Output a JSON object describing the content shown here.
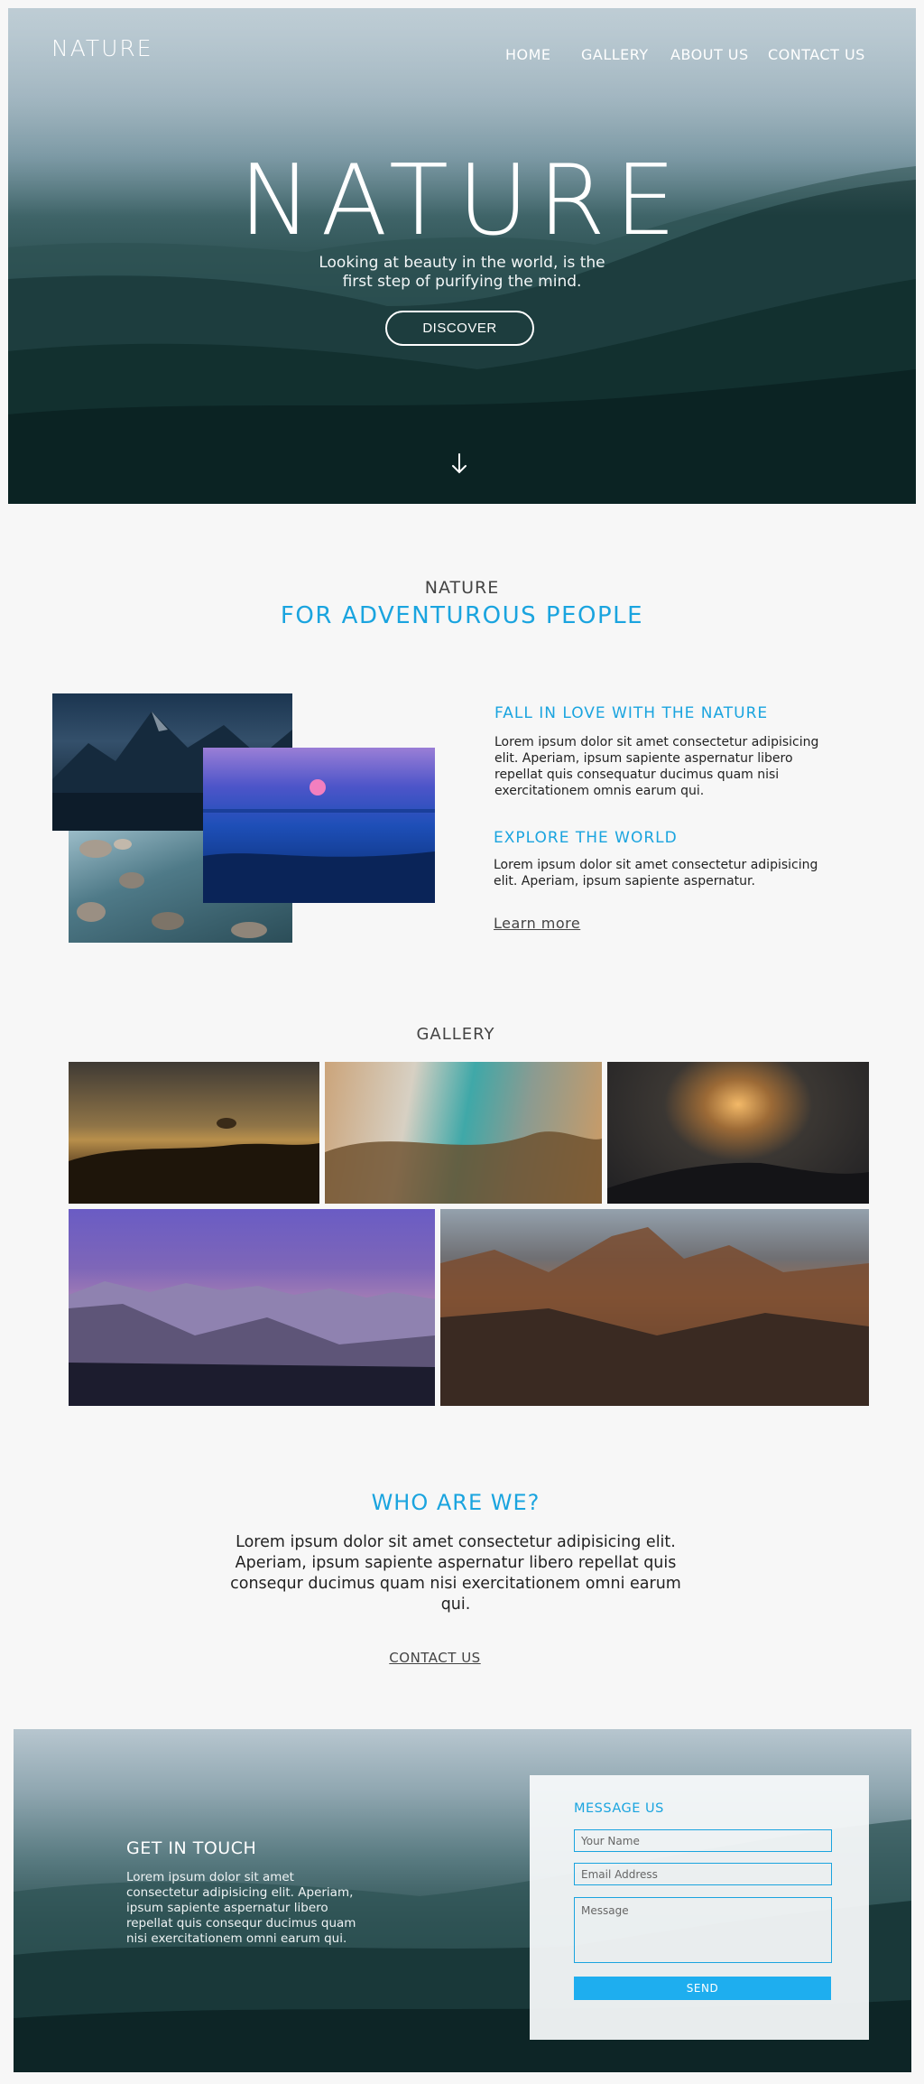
{
  "brand": {
    "logo": "NATURE",
    "accent": "#1aa4df"
  },
  "nav": {
    "items": [
      {
        "label": "HOME"
      },
      {
        "label": "GALLERY"
      },
      {
        "label": "ABOUT US"
      },
      {
        "label": "CONTACT US"
      }
    ]
  },
  "hero": {
    "title": "NATURE",
    "subtitle_line1": "Looking at beauty in the world, is the",
    "subtitle_line2": "first step of purifying the mind.",
    "cta": "DISCOVER",
    "scroll_icon": "arrow-down-icon"
  },
  "intro": {
    "kicker": "NATURE",
    "heading": "FOR ADVENTUROUS PEOPLE",
    "features": [
      {
        "title": "FALL IN LOVE WITH THE NATURE",
        "text": "Lorem ipsum dolor sit amet consectetur adipisicing elit. Aperiam, ipsum sapiente aspernatur libero repellat quis consequatur ducimus quam nisi exercitationem omnis earum qui."
      },
      {
        "title": "EXPLORE THE WORLD",
        "text": "Lorem ipsum dolor sit amet consectetur adipisicing elit. Aperiam, ipsum sapiente aspernatur."
      }
    ],
    "link": "Learn more"
  },
  "gallery": {
    "title": "GALLERY"
  },
  "who": {
    "heading": "WHO ARE WE?",
    "text": "Lorem ipsum dolor sit amet consectetur adipisicing elit. Aperiam, ipsum sapiente aspernatur libero repellat quis consequr ducimus quam nisi exercitationem omni earum qui.",
    "link": "CONTACT US"
  },
  "contact": {
    "heading": "GET IN TOUCH",
    "text": "Lorem ipsum dolor sit amet consectetur adipisicing elit. Aperiam, ipsum sapiente aspernatur libero repellat quis consequr ducimus quam nisi exercitationem omni earum qui.",
    "form": {
      "title": "MESSAGE US",
      "name_placeholder": "Your Name",
      "email_placeholder": "Email Address",
      "message_placeholder": "Message",
      "submit": "SEND"
    }
  }
}
